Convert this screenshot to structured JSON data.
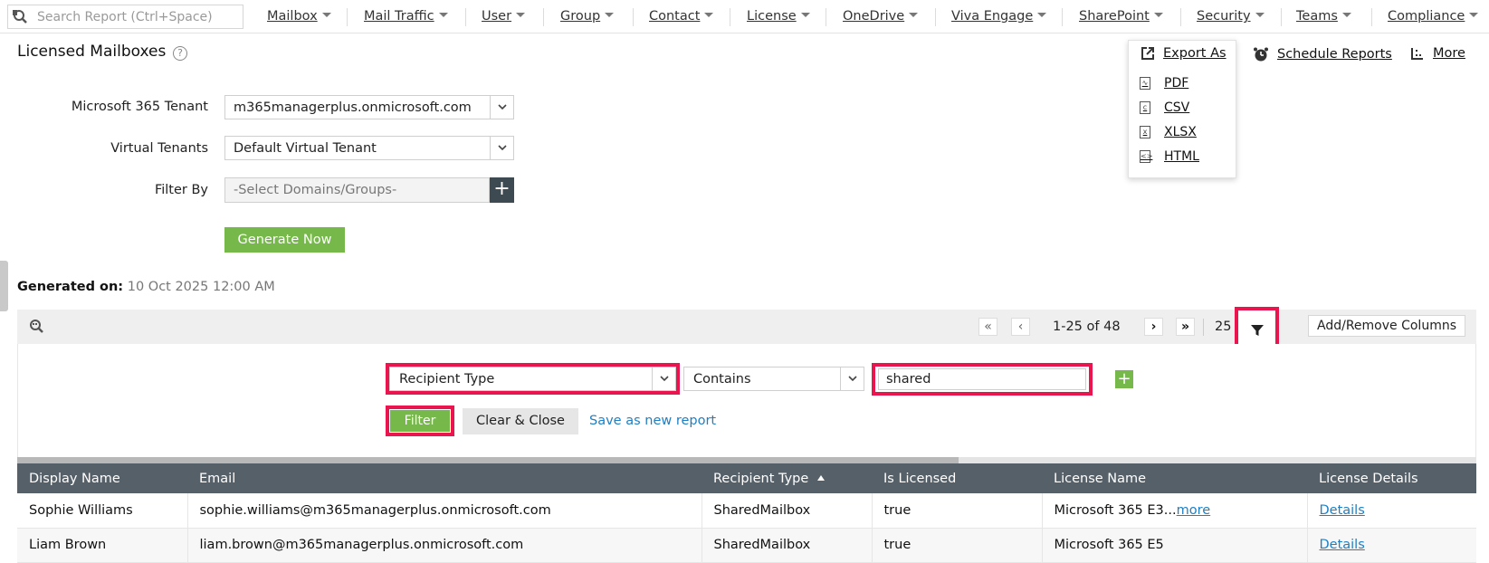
{
  "search": {
    "placeholder": "Search Report (Ctrl+Space)"
  },
  "nav": [
    "Mailbox",
    "Mail Traffic",
    "User",
    "Group",
    "Contact",
    "License",
    "OneDrive",
    "Viva Engage",
    "SharePoint",
    "Security",
    "Teams",
    "Compliance"
  ],
  "page": {
    "title": "Licensed Mailboxes"
  },
  "actions": {
    "export_as": "Export As",
    "schedule": "Schedule Reports",
    "more": "More",
    "export_options": [
      "PDF",
      "CSV",
      "XLSX",
      "HTML"
    ]
  },
  "form": {
    "tenant_label": "Microsoft 365 Tenant",
    "tenant_value": "m365managerplus.onmicrosoft.com",
    "virtual_label": "Virtual Tenants",
    "virtual_value": "Default Virtual Tenant",
    "filter_label": "Filter By",
    "filter_placeholder": "-Select Domains/Groups-",
    "generate_label": "Generate Now"
  },
  "generated": {
    "label": "Generated on:",
    "value": "10 Oct 2025 12:00 AM"
  },
  "toolbar": {
    "page_info": "1-25 of 48",
    "page_size": "25",
    "columns_label": "Add/Remove Columns"
  },
  "filter": {
    "field": "Recipient Type",
    "operator": "Contains",
    "value": "shared",
    "filter_label": "Filter",
    "clear_label": "Clear & Close",
    "save_label": "Save as new report"
  },
  "table": {
    "columns": [
      "Display Name",
      "Email",
      "Recipient Type",
      "Is Licensed",
      "License Name",
      "License Details"
    ],
    "sorted_column": "Recipient Type",
    "rows": [
      {
        "name": "Sophie Williams",
        "email": "sophie.williams@m365managerplus.onmicrosoft.com",
        "type": "SharedMailbox",
        "licensed": "true",
        "license": "Microsoft 365 E3...",
        "license_more": "more",
        "details": "Details"
      },
      {
        "name": "Liam Brown",
        "email": "liam.brown@m365managerplus.onmicrosoft.com",
        "type": "SharedMailbox",
        "licensed": "true",
        "license": "Microsoft 365 E5",
        "license_more": "",
        "details": "Details"
      }
    ]
  },
  "colors": {
    "accent_green": "#76b94a",
    "highlight": "#e8154e",
    "header_bg": "#566069",
    "link": "#1f7fc2"
  }
}
